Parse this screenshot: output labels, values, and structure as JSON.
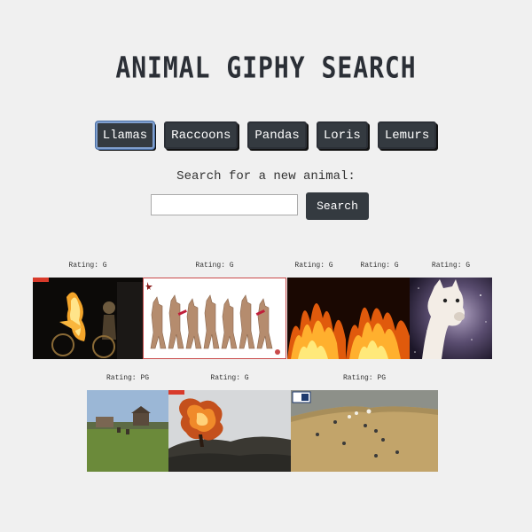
{
  "header": {
    "title": "ANIMAL GIPHY SEARCH"
  },
  "animal_buttons": [
    {
      "label": "Llamas",
      "active": true
    },
    {
      "label": "Raccoons"
    },
    {
      "label": "Pandas"
    },
    {
      "label": "Loris"
    },
    {
      "label": "Lemurs"
    }
  ],
  "search": {
    "label": "Search for a new animal:",
    "input_value": "",
    "button_label": "Search"
  },
  "gifs": [
    {
      "rating": "Rating: G",
      "depicts": "flaming cyclist at night"
    },
    {
      "rating": "Rating: G",
      "depicts": "dancing llamas cartoon"
    },
    {
      "rating": "Rating: G",
      "depicts": "flames"
    },
    {
      "rating": "Rating: G",
      "depicts": "flames"
    },
    {
      "rating": "Rating: G",
      "depicts": "llama head in space"
    },
    {
      "rating": "Rating: PG",
      "depicts": "farm field with llamas"
    },
    {
      "rating": "Rating: G",
      "depicts": "exploding tree"
    },
    {
      "rating": "Rating: PG",
      "depicts": "aerial news footage of llamas"
    }
  ],
  "colors": {
    "background": "#f0f0f0",
    "button_bg": "#343a40",
    "button_text": "#ffffff",
    "active_outline": "#7f9fcf"
  }
}
